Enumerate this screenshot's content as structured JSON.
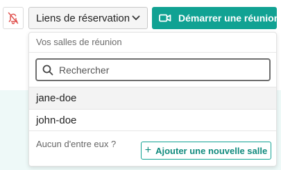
{
  "colors": {
    "primary": "#11a293",
    "bell_muted": "#e0524f",
    "background_tint": "#eef9f8"
  },
  "toolbar": {
    "mute_icon": "bell-slash-icon",
    "links_label": "Liens de réservation",
    "links_icon": "chevron-down-icon",
    "start_label": "Démarrer une réunion",
    "start_icon": "video-camera-icon"
  },
  "dropdown": {
    "heading": "Vos salles de réunion",
    "search": {
      "placeholder": "Rechercher",
      "value": "",
      "icon": "search-icon"
    },
    "rooms": [
      {
        "name": "jane-doe"
      },
      {
        "name": "john-doe"
      }
    ],
    "empty_prompt": "Aucun d'entre eux ?",
    "add_button_label": "Ajouter une nouvelle salle",
    "add_button_icon": "plus-icon"
  }
}
